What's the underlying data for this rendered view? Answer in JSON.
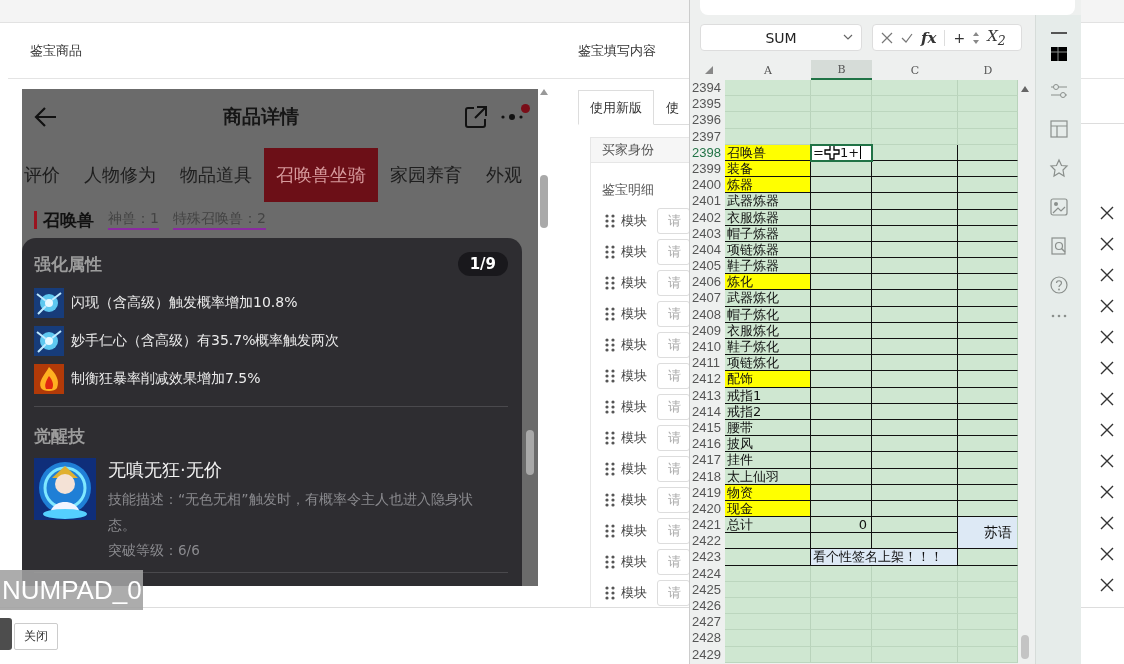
{
  "background_page": {
    "left_panel": {
      "title": "鉴宝商品",
      "phone": {
        "title": "商品详情",
        "tabs": [
          {
            "label": "评价",
            "selected": false
          },
          {
            "label": "人物修为",
            "selected": false
          },
          {
            "label": "物品道具",
            "selected": false
          },
          {
            "label": "召唤兽坐骑",
            "selected": true
          },
          {
            "label": "家园养育",
            "selected": false
          },
          {
            "label": "外观",
            "selected": false
          }
        ],
        "section": {
          "title": "召唤兽",
          "stats": [
            "神兽：1",
            "特殊召唤兽：2"
          ]
        },
        "popup": {
          "heading": "强化属性",
          "pager": "1/9",
          "attributes": [
            {
              "kind": "frost",
              "text": "闪现（含高级）触发概率增加10.8%"
            },
            {
              "kind": "frost",
              "text": "妙手仁心（含高级）有35.7%概率触发两次"
            },
            {
              "kind": "fire",
              "text": "制衡狂暴率削减效果增加7.5%"
            }
          ],
          "skill_heading": "觉醒技",
          "skill": {
            "kind": "picture",
            "name": "无嗔无狂·无价",
            "description": "技能描述：“无色无相”触发时，有概率令主人也进入隐身状态。",
            "breakthrough": "突破等级：6/6"
          }
        }
      }
    },
    "right_panel": {
      "title": "鉴宝填写内容",
      "tabs": [
        {
          "label": "使用新版",
          "selected": true
        },
        {
          "label": "使",
          "selected": false
        }
      ],
      "buyer_label": "买家身份",
      "detail_label": "鉴宝明细",
      "modules": [
        {
          "label": "模块",
          "placeholder": "请"
        },
        {
          "label": "模块",
          "placeholder": "请"
        },
        {
          "label": "模块",
          "placeholder": "请"
        },
        {
          "label": "模块",
          "placeholder": "请"
        },
        {
          "label": "模块",
          "placeholder": "请"
        },
        {
          "label": "模块",
          "placeholder": "请"
        },
        {
          "label": "模块",
          "placeholder": "请"
        },
        {
          "label": "模块",
          "placeholder": "请"
        },
        {
          "label": "模块",
          "placeholder": "请"
        },
        {
          "label": "模块",
          "placeholder": "请"
        },
        {
          "label": "模块",
          "placeholder": "请"
        },
        {
          "label": "模块",
          "placeholder": "请"
        },
        {
          "label": "模块",
          "placeholder": "请"
        }
      ]
    },
    "close_button": "关闭"
  },
  "key_overlay": "NUMPAD_0",
  "spreadsheet": {
    "name_box": "SUM",
    "function_label": "fx",
    "plus_label": "+",
    "equation_label": "X$_{2}$",
    "columns": [
      {
        "label": "A",
        "selected": false
      },
      {
        "label": "B",
        "selected": true
      },
      {
        "label": "C",
        "selected": false
      },
      {
        "label": "D",
        "selected": false
      }
    ],
    "rows": [
      {
        "number": "2394",
        "selected": false,
        "bordered": false
      },
      {
        "number": "2395",
        "selected": false,
        "bordered": false
      },
      {
        "number": "2396",
        "selected": false,
        "bordered": false
      },
      {
        "number": "2397",
        "selected": false,
        "bordered": false
      },
      {
        "number": "2398",
        "selected": true,
        "bordered": true,
        "cells": [
          {
            "kind": "text",
            "text": "召唤兽",
            "highlight": true
          },
          {
            "kind": "editing",
            "text": "=",
            "after_cursor": "1+"
          }
        ]
      },
      {
        "number": "2399",
        "selected": false,
        "bordered": true,
        "cells": [
          {
            "kind": "text",
            "text": "装备",
            "highlight": true
          }
        ]
      },
      {
        "number": "2400",
        "selected": false,
        "bordered": true,
        "cells": [
          {
            "kind": "text",
            "text": "炼器",
            "highlight": true
          }
        ]
      },
      {
        "number": "2401",
        "selected": false,
        "bordered": true,
        "cells": [
          {
            "kind": "text",
            "text": "武器炼器",
            "highlight": false
          }
        ]
      },
      {
        "number": "2402",
        "selected": false,
        "bordered": true,
        "cells": [
          {
            "kind": "text",
            "text": "衣服炼器",
            "highlight": false
          }
        ]
      },
      {
        "number": "2403",
        "selected": false,
        "bordered": true,
        "cells": [
          {
            "kind": "text",
            "text": "帽子炼器",
            "highlight": false
          }
        ]
      },
      {
        "number": "2404",
        "selected": false,
        "bordered": true,
        "cells": [
          {
            "kind": "text",
            "text": "项链炼器",
            "highlight": false
          }
        ]
      },
      {
        "number": "2405",
        "selected": false,
        "bordered": true,
        "cells": [
          {
            "kind": "text",
            "text": "鞋子炼器",
            "highlight": false
          }
        ]
      },
      {
        "number": "2406",
        "selected": false,
        "bordered": true,
        "cells": [
          {
            "kind": "text",
            "text": "炼化",
            "highlight": true
          }
        ]
      },
      {
        "number": "2407",
        "selected": false,
        "bordered": true,
        "cells": [
          {
            "kind": "text",
            "text": "武器炼化",
            "highlight": false
          }
        ]
      },
      {
        "number": "2408",
        "selected": false,
        "bordered": true,
        "cells": [
          {
            "kind": "text",
            "text": "帽子炼化",
            "highlight": false
          }
        ]
      },
      {
        "number": "2409",
        "selected": false,
        "bordered": true,
        "cells": [
          {
            "kind": "text",
            "text": "衣服炼化",
            "highlight": false
          }
        ]
      },
      {
        "number": "2410",
        "selected": false,
        "bordered": true,
        "cells": [
          {
            "kind": "text",
            "text": "鞋子炼化",
            "highlight": false
          }
        ]
      },
      {
        "number": "2411",
        "selected": false,
        "bordered": true,
        "cells": [
          {
            "kind": "text",
            "text": "项链炼化",
            "highlight": false
          }
        ]
      },
      {
        "number": "2412",
        "selected": false,
        "bordered": true,
        "cells": [
          {
            "kind": "text",
            "text": "配饰",
            "highlight": true
          }
        ]
      },
      {
        "number": "2413",
        "selected": false,
        "bordered": true,
        "cells": [
          {
            "kind": "text",
            "text": "戒指1",
            "highlight": false
          }
        ]
      },
      {
        "number": "2414",
        "selected": false,
        "bordered": true,
        "cells": [
          {
            "kind": "text",
            "text": "戒指2",
            "highlight": false
          }
        ]
      },
      {
        "number": "2415",
        "selected": false,
        "bordered": true,
        "cells": [
          {
            "kind": "text",
            "text": "腰带",
            "highlight": false
          }
        ]
      },
      {
        "number": "2416",
        "selected": false,
        "bordered": true,
        "cells": [
          {
            "kind": "text",
            "text": "披风",
            "highlight": false
          }
        ]
      },
      {
        "number": "2417",
        "selected": false,
        "bordered": true,
        "cells": [
          {
            "kind": "text",
            "text": "挂件",
            "highlight": false
          }
        ]
      },
      {
        "number": "2418",
        "selected": false,
        "bordered": true,
        "cells": [
          {
            "kind": "text",
            "text": "太上仙羽",
            "highlight": false
          }
        ]
      },
      {
        "number": "2419",
        "selected": false,
        "bordered": true,
        "cells": [
          {
            "kind": "text",
            "text": "物资",
            "highlight": true
          }
        ]
      },
      {
        "number": "2420",
        "selected": false,
        "bordered": true,
        "cells": [
          {
            "kind": "text",
            "text": "现金",
            "highlight": true
          }
        ]
      },
      {
        "number": "2421",
        "selected": false,
        "bordered": true,
        "cells": [
          {
            "kind": "text",
            "text": "总计",
            "highlight": false
          },
          {
            "kind": "number",
            "text": "0"
          },
          {
            "kind": "blank"
          },
          {
            "kind": "note",
            "rowspan": 2,
            "text": "苏语"
          }
        ]
      },
      {
        "number": "2422",
        "selected": false,
        "bordered": true
      },
      {
        "number": "2423",
        "selected": false,
        "bordered": true,
        "cells": [
          {
            "kind": "blank"
          },
          {
            "kind": "merged",
            "colspan": 2,
            "text": "看个性签名上架！！！"
          }
        ]
      },
      {
        "number": "2424",
        "selected": false,
        "bordered": false
      },
      {
        "number": "2425",
        "selected": false,
        "bordered": false
      },
      {
        "number": "2426",
        "selected": false,
        "bordered": false
      },
      {
        "number": "2427",
        "selected": false,
        "bordered": false
      },
      {
        "number": "2428",
        "selected": false,
        "bordered": false
      },
      {
        "number": "2429",
        "selected": false,
        "bordered": false
      }
    ]
  }
}
